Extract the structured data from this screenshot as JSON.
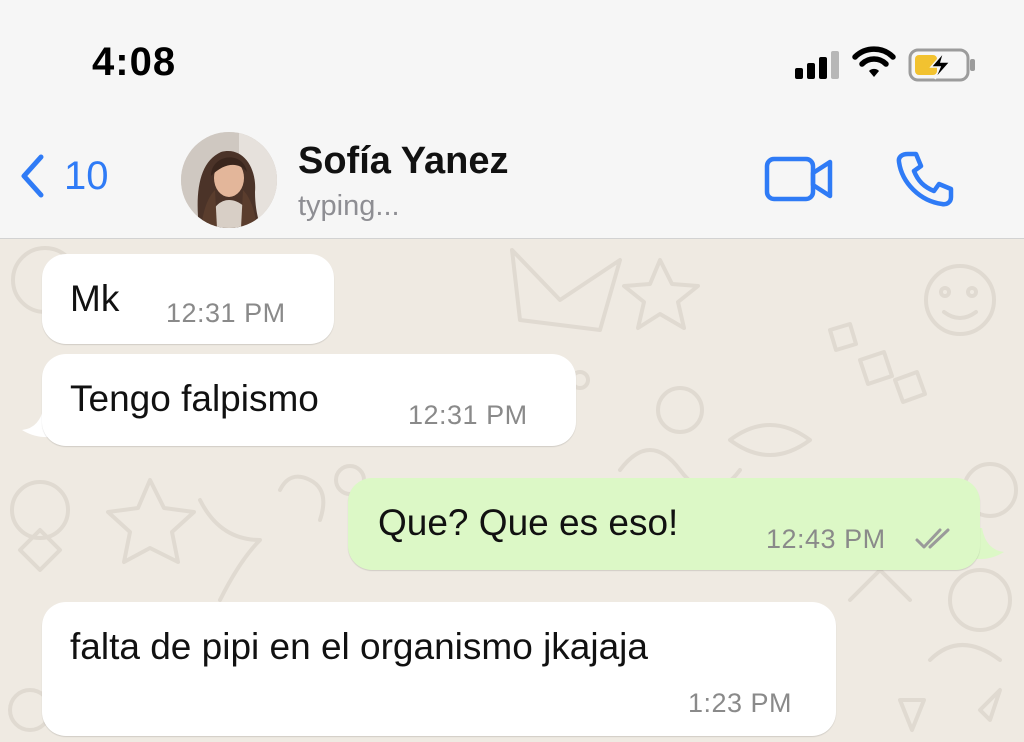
{
  "status_bar": {
    "time": "4:08",
    "icons": [
      "signal-bars-icon",
      "wifi-icon",
      "battery-charging-icon"
    ]
  },
  "header": {
    "back_count": "10",
    "contact_name": "Sofía Yanez",
    "contact_status": "typing...",
    "icons": [
      "chevron-left-icon",
      "video-camera-icon",
      "phone-icon"
    ],
    "accent_color": "#2f7bf6"
  },
  "messages": [
    {
      "direction": "incoming",
      "text": "Mk",
      "time": "12:31 PM"
    },
    {
      "direction": "incoming",
      "text": "Tengo falpismo",
      "time": "12:31 PM"
    },
    {
      "direction": "outgoing",
      "text": "Que? Que es eso!",
      "time": "12:43 PM",
      "status": "read"
    },
    {
      "direction": "incoming",
      "text": "falta de pipi en el organismo jkajaja",
      "time": "1:23 PM"
    }
  ],
  "colors": {
    "incoming_bubble": "#ffffff",
    "outgoing_bubble": "#dcf8c6",
    "chat_background": "#efeae2",
    "header_background": "#f6f6f6"
  }
}
